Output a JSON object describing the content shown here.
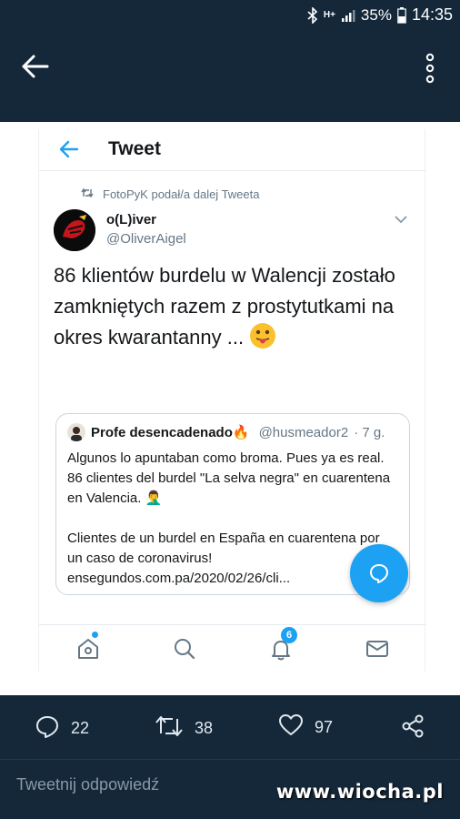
{
  "status_bar": {
    "network": "H+",
    "battery": "35%",
    "time": "14:35"
  },
  "app_bar": {
    "back_icon": "arrow-left-icon",
    "menu_icon": "more-vertical-icon"
  },
  "tweet_screen": {
    "header_title": "Tweet",
    "retweeted_by": "FotoPyK podał/a dalej Tweeta",
    "author": {
      "name": "o(L)iver",
      "handle": "@OliverAigel"
    },
    "text": "86 klientów burdelu w Walencji zostało zamkniętych razem z prostytutkami na okres kwarantanny ...",
    "emoji_icon": "tongue-face-icon",
    "quoted": {
      "name": "Profe desencadenado🔥",
      "handle": "@husmeador2",
      "time": "· 7 g.",
      "body": "Algunos lo apuntaban como broma. Pues ya es real. 86 clientes del burdel \"La selva negra\" en cuarentena en Valencia. 🤦‍♂️\n\nClientes de un burdel en España en cuarentena por un caso de coronavirus!\nensegundos.com.pa/2020/02/26/cli..."
    },
    "nav": {
      "notifications_badge": "6"
    }
  },
  "actions": {
    "replies": "22",
    "retweets": "38",
    "likes": "97"
  },
  "reply_placeholder": "Tweetnij odpowiedź",
  "watermark": "www.wiocha.pl",
  "colors": {
    "background": "#14283a",
    "accent": "#1da1f2"
  }
}
